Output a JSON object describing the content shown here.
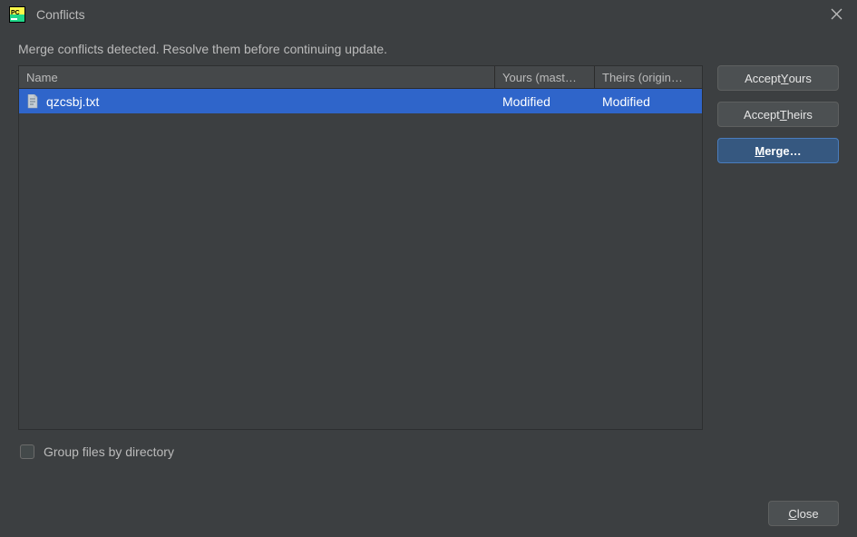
{
  "window": {
    "title": "Conflicts"
  },
  "instruction": "Merge conflicts detected. Resolve them before continuing update.",
  "table": {
    "headers": {
      "name": "Name",
      "yours": "Yours (mast…",
      "theirs": "Theirs (origin…"
    },
    "rows": [
      {
        "file": "qzcsbj.txt",
        "yours": "Modified",
        "theirs": "Modified"
      }
    ]
  },
  "actions": {
    "accept_yours_pre": "Accept ",
    "accept_yours_m": "Y",
    "accept_yours_post": "ours",
    "accept_theirs_pre": "Accept ",
    "accept_theirs_m": "T",
    "accept_theirs_post": "heirs",
    "merge_m": "M",
    "merge_post": "erge…"
  },
  "option": {
    "group_label": "Group files by directory",
    "checked": false
  },
  "footer": {
    "close_m": "C",
    "close_post": "lose"
  }
}
